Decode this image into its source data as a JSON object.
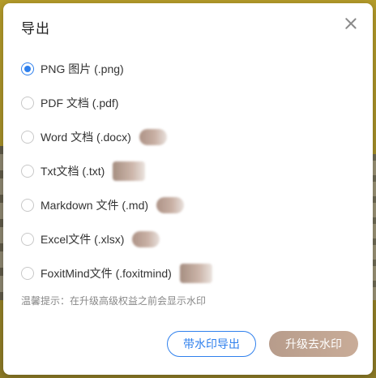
{
  "dialog": {
    "title": "导出",
    "hint": "温馨提示：在升级高级权益之前会显示水印",
    "buttons": {
      "export_with_watermark": "带水印导出",
      "upgrade_remove_watermark": "升级去水印"
    }
  },
  "options": [
    {
      "label": "PNG 图片 (.png)",
      "checked": true,
      "vip": false
    },
    {
      "label": "PDF 文档 (.pdf)",
      "checked": false,
      "vip": false
    },
    {
      "label": "Word 文档 (.docx)",
      "checked": false,
      "vip": true
    },
    {
      "label": "Txt文档  (.txt)",
      "checked": false,
      "vip": true
    },
    {
      "label": "Markdown 文件 (.md)",
      "checked": false,
      "vip": true
    },
    {
      "label": "Excel文件 (.xlsx)",
      "checked": false,
      "vip": true
    },
    {
      "label": "FoxitMind文件 (.foxitmind)",
      "checked": false,
      "vip": true
    }
  ],
  "colors": {
    "accent": "#2f80ed",
    "vip": "#c2a79a"
  },
  "icons": {
    "close": "close-icon",
    "vip": "vip-badge-icon"
  }
}
